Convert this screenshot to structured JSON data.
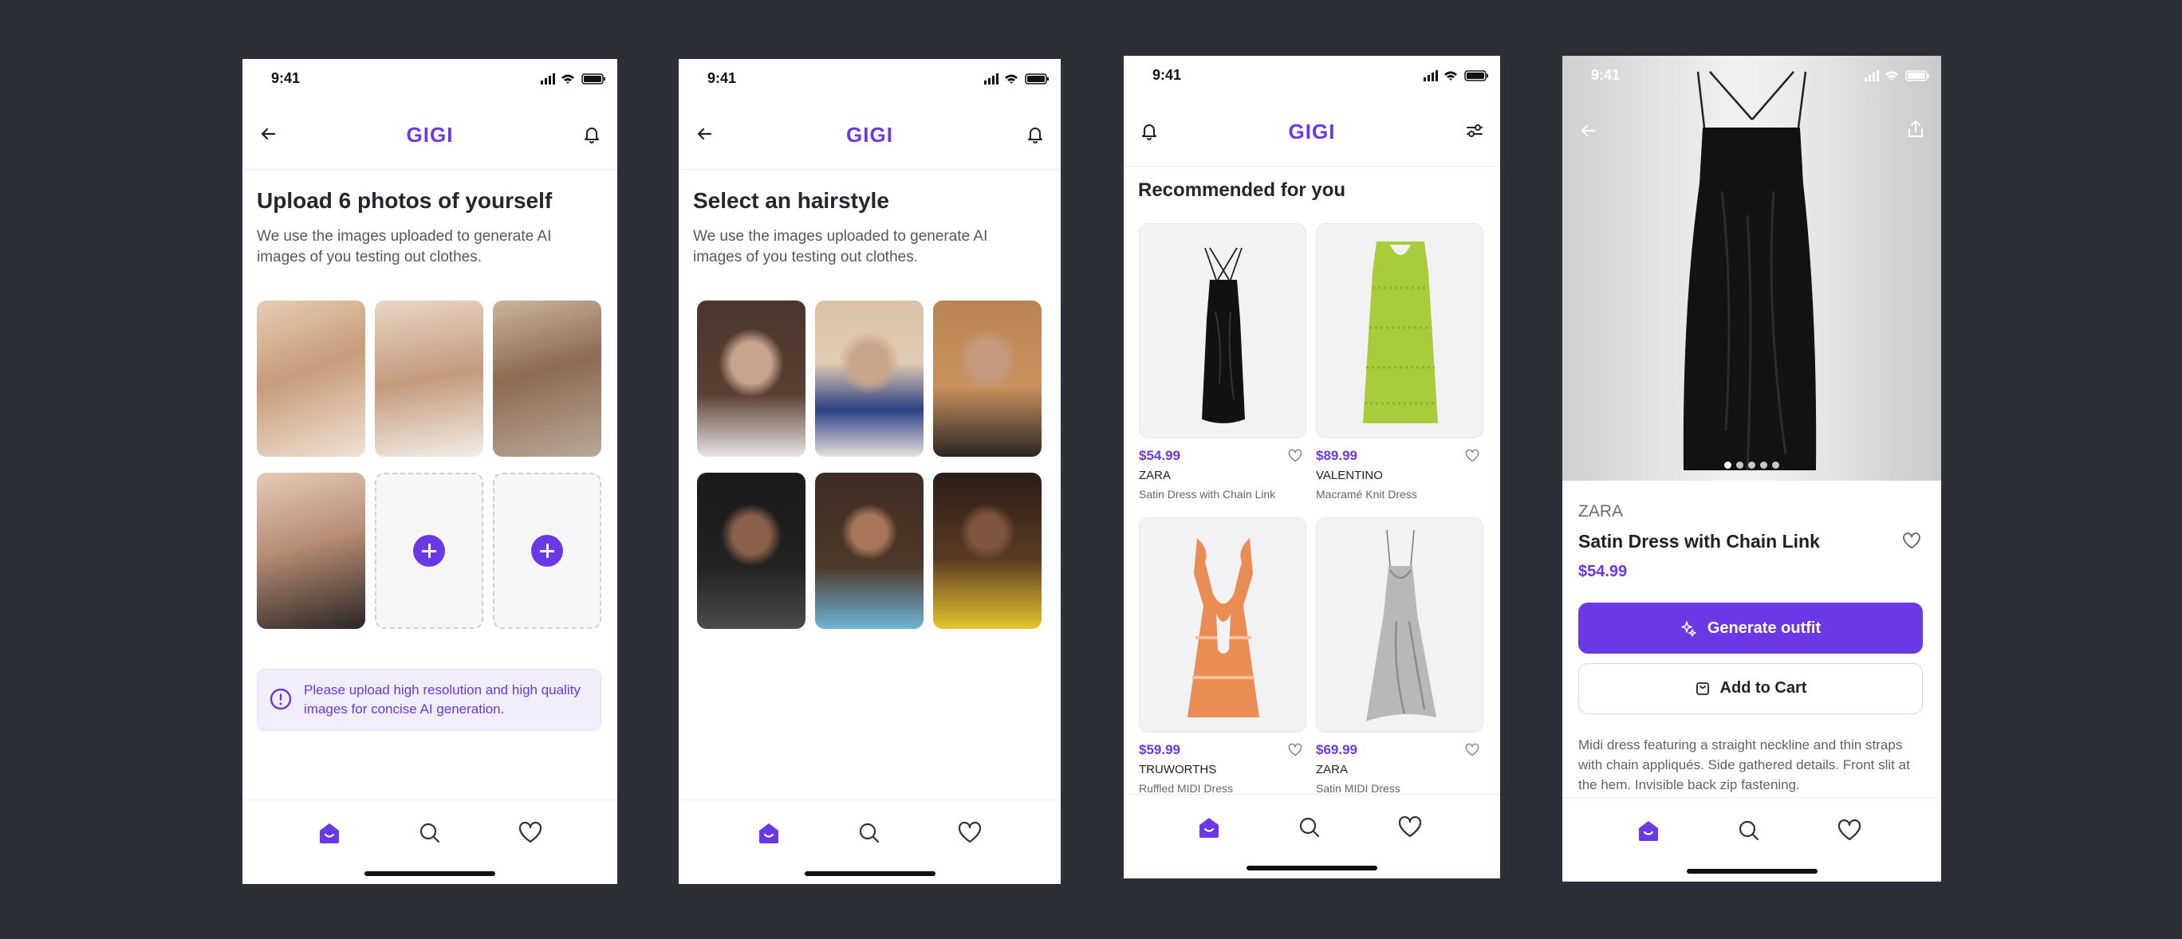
{
  "status_time": "9:41",
  "app_logo": "GIGI",
  "screen1": {
    "title": "Upload 6 photos of yourself",
    "subtitle": "We use the images uploaded to generate AI images of you testing out clothes.",
    "notice": "Please upload high resolution and high quality images for concise AI generation."
  },
  "screen2": {
    "title": "Select an hairstyle",
    "subtitle": "We use the images uploaded to generate AI images of you testing out clothes."
  },
  "screen3": {
    "section_title": "Recommended for you",
    "products": [
      {
        "price": "$54.99",
        "brand": "ZARA",
        "name": "Satin Dress with Chain Link"
      },
      {
        "price": "$89.99",
        "brand": "VALENTINO",
        "name": "Macramé Knit Dress"
      },
      {
        "price": "$59.99",
        "brand": "TRUWORTHS",
        "name": "Ruffled MIDI Dress"
      },
      {
        "price": "$69.99",
        "brand": "ZARA",
        "name": "Satin MIDI Dress"
      }
    ]
  },
  "screen4": {
    "brand": "ZARA",
    "name": "Satin Dress with Chain Link",
    "price": "$54.99",
    "generate_label": "Generate outfit",
    "cart_label": "Add to Cart",
    "description": "Midi dress featuring a straight neckline and thin straps with chain appliqués. Side gathered details. Front slit at the hem. Invisible back zip fastening.",
    "carousel_active_index": 1,
    "carousel_count": 5
  },
  "colors": {
    "accent": "#6b38e6",
    "background": "#2d2f38"
  }
}
